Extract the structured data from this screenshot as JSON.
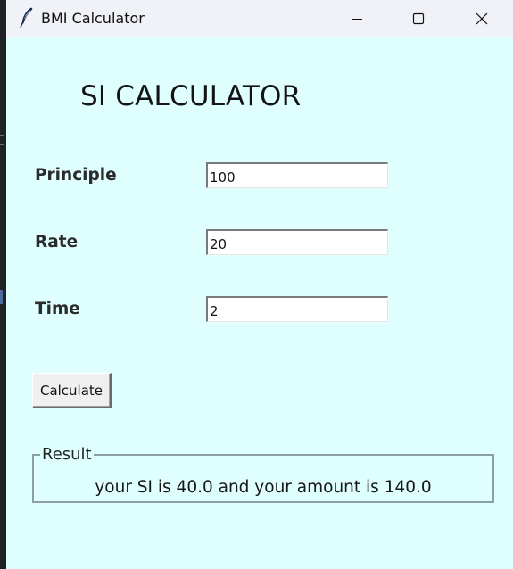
{
  "window": {
    "title": "BMI Calculator",
    "icon": "feather-icon",
    "controls": {
      "minimize_icon": "minimize-icon",
      "maximize_icon": "maximize-icon",
      "close_icon": "close-icon"
    },
    "background": "#dfffff"
  },
  "app": {
    "heading": "SI CALCULATOR"
  },
  "form": {
    "principle": {
      "label": "Principle",
      "value": "100"
    },
    "rate": {
      "label": "Rate",
      "value": "20"
    },
    "time": {
      "label": "Time",
      "value": "2"
    }
  },
  "actions": {
    "calculate_label": "Calculate"
  },
  "result": {
    "legend": "Result",
    "text": "your SI is 40.0 and your amount is 140.0"
  }
}
